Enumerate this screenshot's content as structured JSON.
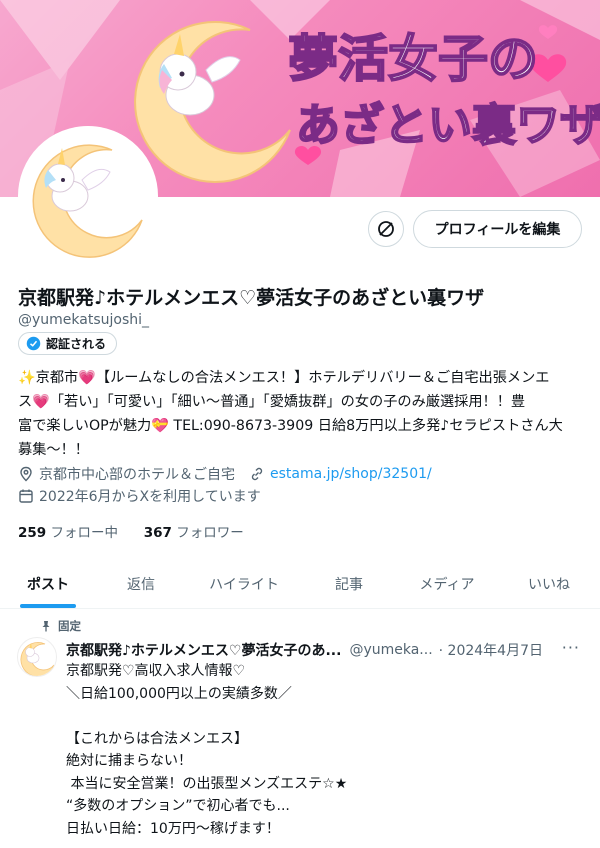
{
  "banner": {
    "title_line1": "夢活女子の",
    "title_line2": "あざとい裏ワザ"
  },
  "actions": {
    "edit_profile": "プロフィールを編集"
  },
  "profile": {
    "name": "京都駅発♪ホテルメンエス♡夢活女子のあざとい裏ワザ",
    "handle": "@yumekatsujoshi_",
    "verified_label": "認証される",
    "bio_lines": [
      "✨京都市💗【ルームなしの合法メンエス！】ホテルデリバリー＆ご自宅出張メンエ",
      "ス💗「若い」「可愛い」「細い〜普通」「愛嬌抜群」の女の子のみ厳選採用！！豊",
      "富で楽しいOPが魅力💝 TEL:090-8673-3909 日給8万円以上多発♪セラピストさん大",
      "募集〜！！"
    ],
    "location": "京都市中心部のホテル＆ご自宅",
    "website": "estama.jp/shop/32501/",
    "joined": "2022年6月からXを利用しています",
    "following_count": "259",
    "following_label": "フォロー中",
    "followers_count": "367",
    "followers_label": "フォロワー"
  },
  "tabs": [
    {
      "label": "ポスト",
      "active": true
    },
    {
      "label": "返信",
      "active": false
    },
    {
      "label": "ハイライト",
      "active": false
    },
    {
      "label": "記事",
      "active": false
    },
    {
      "label": "メディア",
      "active": false
    },
    {
      "label": "いいね",
      "active": false
    }
  ],
  "pinned_tweet": {
    "pinned_label": "固定",
    "name": "京都駅発♪ホテルメンエス♡夢活女子のあ...",
    "handle": "@yumeka...",
    "date": "· 2024年4月7日",
    "more": "···",
    "body": "京都駅発♡高収入求人情報♡\n＼日給100,000円以上の実績多数／\n\n【これからは合法メンエス】\n絶対に捕まらない！\n 本当に安全営業！の出張型メンズエステ☆★\n“多数のオプション”で初心者でも...\n日払い日給：10万円〜稼げます！"
  },
  "colors": {
    "accent": "#1d9bf0",
    "banner_pink": "#f58bbd",
    "title_purple": "#7b2b86"
  }
}
